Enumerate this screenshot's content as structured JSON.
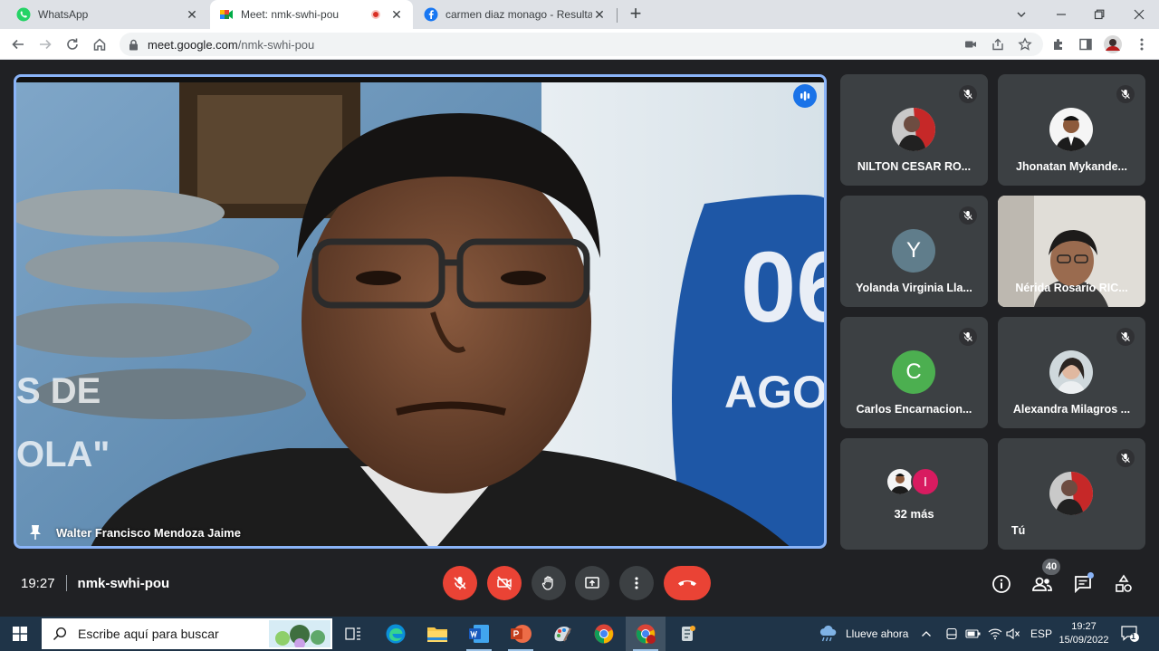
{
  "browser": {
    "tabs": [
      {
        "title": "WhatsApp",
        "icon": "whatsapp-icon",
        "active": false
      },
      {
        "title": "Meet: nmk-swhi-pou",
        "icon": "google-meet-icon",
        "active": true,
        "recording": true
      },
      {
        "title": "carmen diaz monago - Resultado",
        "icon": "facebook-icon",
        "active": false
      }
    ],
    "address": {
      "domain": "meet.google.com",
      "path": "/nmk-swhi-pou"
    }
  },
  "meeting": {
    "time": "19:27",
    "code": "nmk-swhi-pou",
    "participant_count": "40",
    "main_speaker": {
      "name": "Walter Francisco Mendoza Jaime"
    },
    "tiles": [
      {
        "name": "NILTON CESAR RO...",
        "kind": "photo",
        "muted": true
      },
      {
        "name": "Jhonatan Mykande...",
        "kind": "photo",
        "muted": true
      },
      {
        "name": "Yolanda Virginia Lla...",
        "kind": "letter",
        "letter": "Y",
        "color": "#607d8b",
        "muted": true
      },
      {
        "name": "Nérida Rosario RIC...",
        "kind": "video",
        "muted": false
      },
      {
        "name": "Carlos Encarnacion...",
        "kind": "letter",
        "letter": "C",
        "color": "#4caf50",
        "muted": true
      },
      {
        "name": "Alexandra Milagros ...",
        "kind": "photo",
        "muted": true
      },
      {
        "name": "32 más",
        "kind": "more",
        "letter": "I",
        "color": "#d81b60"
      },
      {
        "name": "Tú",
        "kind": "photo",
        "muted": true
      }
    ]
  },
  "colors": {
    "hangup": "#ea4335",
    "accent": "#8ab4f8",
    "background": "#202124",
    "tile": "#3c4043"
  },
  "taskbar": {
    "search_placeholder": "Escribe aquí para buscar",
    "weather": "Llueve ahora",
    "language": "ESP",
    "time": "19:27",
    "date": "15/09/2022",
    "notifications": "1"
  }
}
